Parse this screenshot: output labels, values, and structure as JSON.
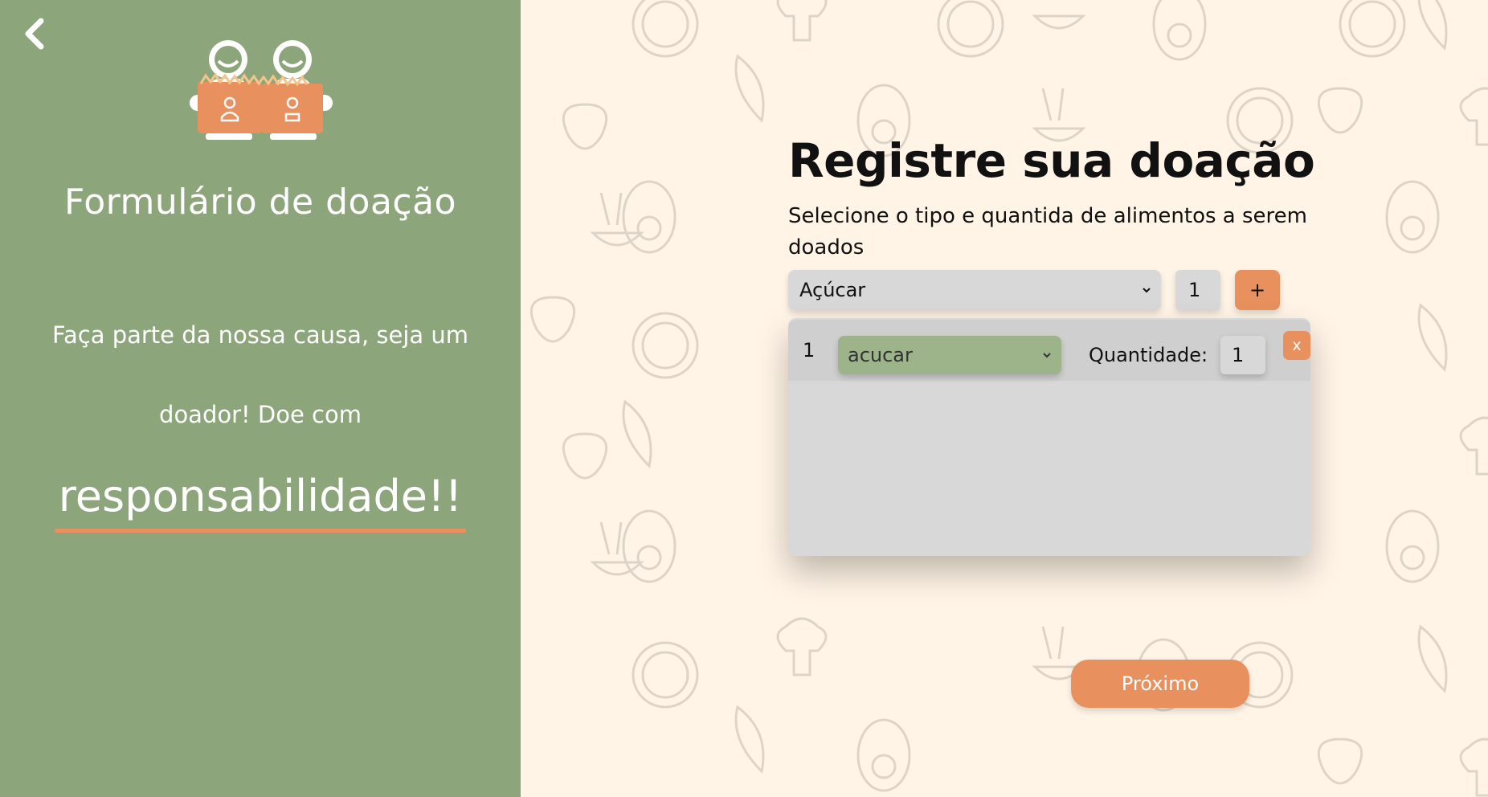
{
  "sidebar": {
    "back_icon": "chevron-left-icon",
    "logo_icon": "two-people-holding-food-boxes-logo",
    "title": "Formulário de doação",
    "slogan_line1": "Faça parte da nossa causa, seja um",
    "slogan_line2": "doador! Doe com",
    "slogan_highlight": "responsabilidade!!",
    "background_color": "#8da57b",
    "accent_color": "#e8915f"
  },
  "main": {
    "title": "Registre sua doação",
    "subtitle": "Selecione o tipo e quantida de alimentos a serem doados",
    "food_select_value": "Açúcar",
    "quantity_value": "1",
    "add_label": "+",
    "donation_rows": [
      {
        "index": "1",
        "food": "acucar",
        "quantity_label": "Quantidade:",
        "quantity": "1",
        "remove_label": "x"
      }
    ],
    "next_label": "Próximo",
    "background_color": "#fff4e6"
  }
}
